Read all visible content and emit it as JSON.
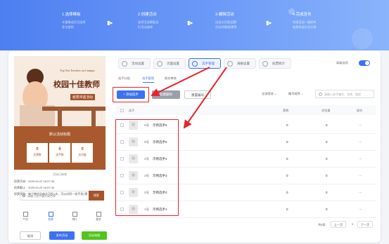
{
  "steps": [
    {
      "title": "1.选择模板",
      "desc": [
        "丰富精选页活选择",
        "多位使用"
      ]
    },
    {
      "title": "2.创建活动",
      "desc": [
        "选择活选模板设",
        "行活动选择"
      ]
    },
    {
      "title": "3.编辑活动",
      "desc": [
        "自定义页面设置/",
        "活动详情/投票等"
      ]
    },
    {
      "title": "4.完成发布",
      "desc": [
        "完成活动一键发布",
        "选择合适方式分享"
      ]
    }
  ],
  "poster": {
    "en_title": "Top Ten Teachers on Campus",
    "cn_title": "校园十佳教师",
    "cn_sub": "投票评选活动"
  },
  "stats": {
    "title": "默认活动标题",
    "items": [
      {
        "value": "0",
        "label": "总票数"
      },
      {
        "value": "6",
        "label": "选手数"
      },
      {
        "value": "0",
        "label": "访问量"
      }
    ]
  },
  "info": {
    "head": "活动已结束",
    "rows": [
      "投票开始：2025-04-22 16:57:34",
      "投票截止：2025-04-29 16:57:34",
      "投票规则：每个微信号每天可投1次，可以对同一选手投1票"
    ]
  },
  "left_search": {
    "placeholder": "请输入选手编号或名称",
    "button": "搜索"
  },
  "left_toolbar": [
    {
      "label": "介绍",
      "icon": "intro-icon"
    },
    {
      "label": "投票",
      "icon": "vote-icon"
    },
    {
      "label": "排行",
      "icon": "rank-icon"
    },
    {
      "label": "报名",
      "icon": "signup-icon"
    }
  ],
  "bottom_buttons": {
    "cancel": "取消",
    "publish": "发布活动",
    "preview": "活动海报"
  },
  "tabs": [
    {
      "label": "活动设置"
    },
    {
      "label": "页面设置"
    },
    {
      "label": "选手管理"
    },
    {
      "label": "海报设置"
    },
    {
      "label": "投票统计"
    }
  ],
  "switch_label": "高级选项",
  "subtabs": [
    "选手分组",
    "选手管理",
    "报名审核"
  ],
  "actions": {
    "add": "+ 添加选手",
    "batch": "批量删除",
    "number": "重置编号"
  },
  "filters": {
    "all": "全部筛选",
    "sort": "编号顺序"
  },
  "search2": {
    "placeholder": "请输入选手编号、名称、描述"
  },
  "table": {
    "headers": [
      "选手",
      "票数",
      "浏览量",
      "操作"
    ],
    "rows": [
      {
        "num": "6号",
        "name": "示例选手6",
        "votes": "0",
        "views": "0",
        "op": "···"
      },
      {
        "num": "5号",
        "name": "示例选手5",
        "votes": "0",
        "views": "0",
        "op": "···"
      },
      {
        "num": "4号",
        "name": "示例选手4",
        "votes": "0",
        "views": "0",
        "op": "···"
      },
      {
        "num": "3号",
        "name": "示例选手3",
        "votes": "0",
        "views": "0",
        "op": "···"
      },
      {
        "num": "2号",
        "name": "示例选手2",
        "votes": "0",
        "views": "0",
        "op": "···"
      },
      {
        "num": "1号",
        "name": "示例选手1",
        "votes": "0",
        "views": "0",
        "op": "···"
      }
    ]
  },
  "pager": {
    "total": "共6条",
    "prev": "上一页",
    "page": "1",
    "next": "下一页"
  },
  "colors": {
    "accent": "#3b71f5",
    "annotation": "#e8232b",
    "poster_brown": "#a85a2e",
    "preview_green": "#52c41a"
  }
}
